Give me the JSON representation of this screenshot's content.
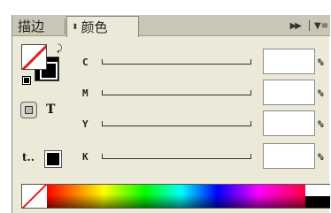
{
  "tabs": [
    {
      "label": "描边"
    },
    {
      "label": "颜色",
      "active": true
    }
  ],
  "panel_menu": {
    "expand_icon": "double-right-arrow",
    "menu_icon": "panel-menu-lines"
  },
  "fill_stroke": {
    "fill": "none",
    "stroke": "#000000",
    "swap_icon": "curved-double-arrow",
    "default_icon": "default-fill-stroke"
  },
  "apply_to": {
    "container_label": "",
    "text_label": "T"
  },
  "tint_label": "t..",
  "last_color": "#000000",
  "channels": [
    {
      "label": "C",
      "value": "",
      "unit": "%"
    },
    {
      "label": "M",
      "value": "",
      "unit": "%"
    },
    {
      "label": "Y",
      "value": "",
      "unit": "%"
    },
    {
      "label": "K",
      "value": "",
      "unit": "%"
    }
  ],
  "spectrum": {
    "none": "none",
    "end_colors": [
      "#ffffff",
      "#000000"
    ]
  },
  "colors": {
    "panel_bg": "#ece9d8",
    "tab_bar_bg": "#c9c6b6",
    "none_slash": "#e02020"
  }
}
